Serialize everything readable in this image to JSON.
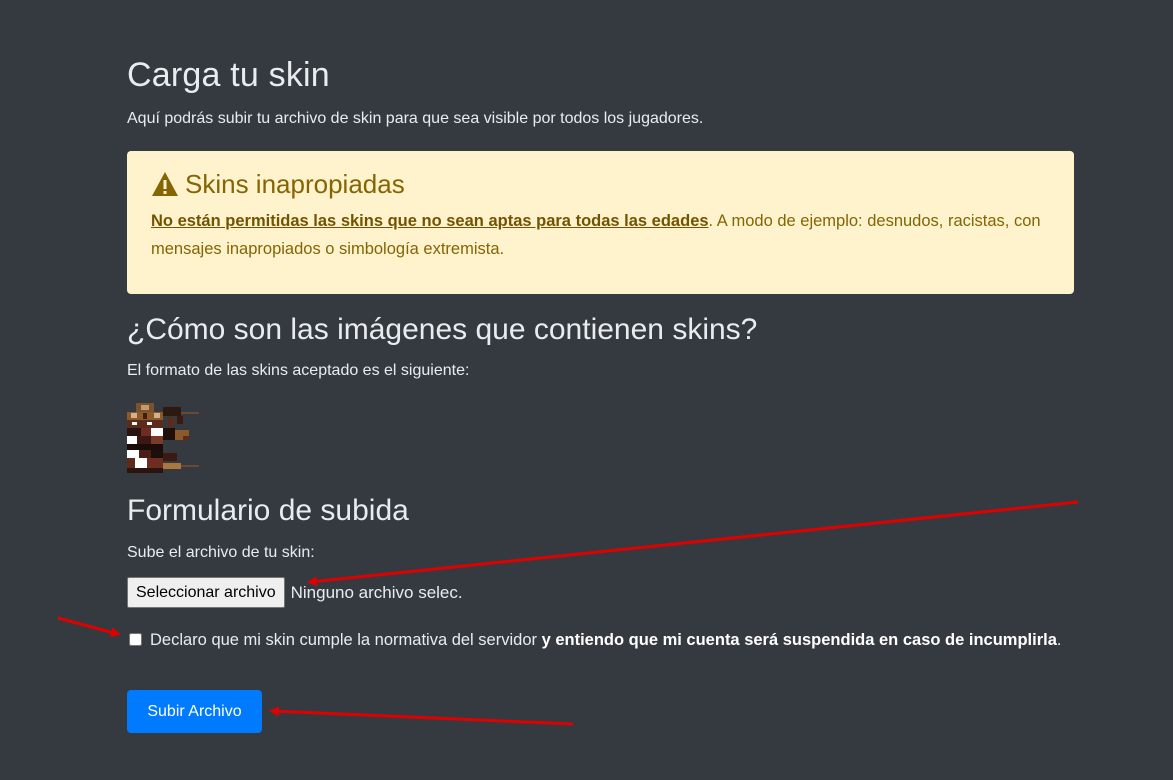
{
  "header": {
    "title": "Carga tu skin",
    "subtitle": "Aquí podrás subir tu archivo de skin para que sea visible por todos los jugadores."
  },
  "alert": {
    "icon": "warning-icon",
    "heading": "Skins inapropiadas",
    "bold_text": "No están permitidas las skins que no sean aptas para todas las edades",
    "rest_text": ". A modo de ejemplo: desnudos, racistas, con mensajes inapropiados o simbología extremista.",
    "bg_color": "#fff3cd",
    "text_color": "#856404"
  },
  "format_section": {
    "heading": "¿Cómo son las imágenes que contienen skins?",
    "text": "El formato de las skins aceptado es el siguiente:"
  },
  "upload_form": {
    "heading": "Formulario de subida",
    "file_label": "Sube el archivo de tu skin:",
    "file_button": "Seleccionar archivo",
    "file_status": "Ninguno archivo selec.",
    "checkbox_text": "Declaro que mi skin cumple la normativa del servidor ",
    "checkbox_bold": "y entiendo que mi cuenta será suspendida en caso de incumplirla",
    "checkbox_end": ".",
    "checkbox_checked": false,
    "submit_label": "Subir Archivo",
    "submit_color": "#007bff"
  },
  "annotation_color": "#e00000"
}
